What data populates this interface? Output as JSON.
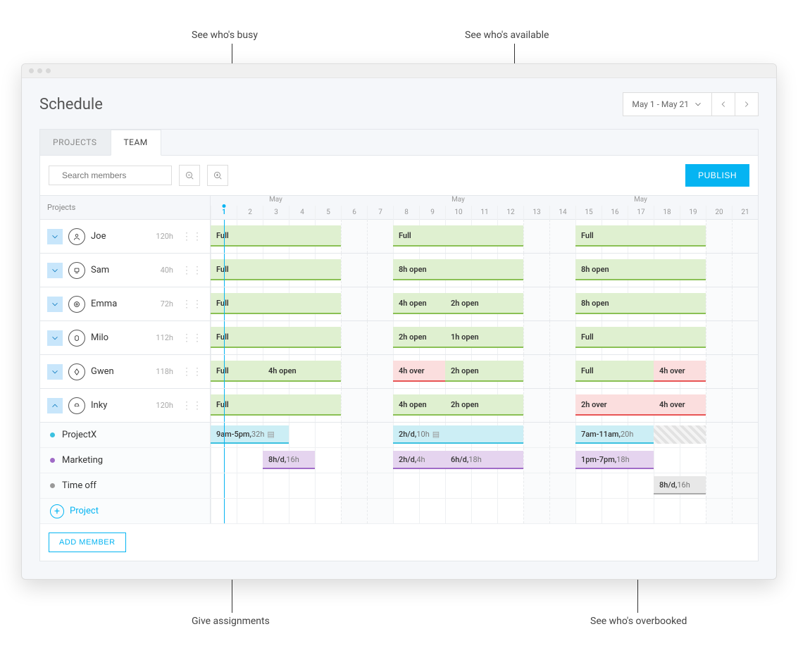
{
  "callouts": {
    "busy": "See who's busy",
    "available": "See who's available",
    "assignments": "Give assignments",
    "overbooked": "See who's overbooked"
  },
  "header": {
    "title": "Schedule",
    "date_range": "May 1 - May 21"
  },
  "tabs": {
    "projects": "PROJECTS",
    "team": "TEAM"
  },
  "toolbar": {
    "search_placeholder": "Search members",
    "publish": "PUBLISH"
  },
  "grid": {
    "left_header": "Projects",
    "month_label": "May",
    "days": [
      "1",
      "2",
      "3",
      "4",
      "5",
      "6",
      "7",
      "8",
      "9",
      "10",
      "11",
      "12",
      "13",
      "14",
      "15",
      "16",
      "17",
      "18",
      "19",
      "20",
      "21"
    ],
    "today": "1"
  },
  "members": [
    {
      "name": "Joe",
      "hours": "120h",
      "bars": [
        {
          "col": 0,
          "span": 5,
          "type": "green",
          "text": "Full"
        },
        {
          "col": 7,
          "span": 5,
          "type": "green",
          "text": "Full"
        },
        {
          "col": 14,
          "span": 5,
          "type": "green",
          "text": "Full"
        }
      ]
    },
    {
      "name": "Sam",
      "hours": "40h",
      "bars": [
        {
          "col": 0,
          "span": 5,
          "type": "green",
          "text": "Full"
        },
        {
          "col": 7,
          "span": 5,
          "type": "green",
          "text": "8h open"
        },
        {
          "col": 14,
          "span": 5,
          "type": "green",
          "text": "8h open"
        }
      ]
    },
    {
      "name": "Emma",
      "hours": "72h",
      "bars": [
        {
          "col": 0,
          "span": 5,
          "type": "green",
          "text": "Full"
        },
        {
          "col": 7,
          "span": 2,
          "type": "green",
          "text": "4h open"
        },
        {
          "col": 9,
          "span": 3,
          "type": "green",
          "text": "2h open"
        },
        {
          "col": 14,
          "span": 5,
          "type": "green",
          "text": "8h open"
        }
      ]
    },
    {
      "name": "Milo",
      "hours": "112h",
      "bars": [
        {
          "col": 0,
          "span": 5,
          "type": "green",
          "text": "Full"
        },
        {
          "col": 7,
          "span": 2,
          "type": "green",
          "text": "2h open"
        },
        {
          "col": 9,
          "span": 3,
          "type": "green",
          "text": "1h open"
        },
        {
          "col": 14,
          "span": 5,
          "type": "green",
          "text": "Full"
        }
      ]
    },
    {
      "name": "Gwen",
      "hours": "118h",
      "bars": [
        {
          "col": 0,
          "span": 2,
          "type": "green",
          "text": "Full"
        },
        {
          "col": 2,
          "span": 3,
          "type": "green",
          "text": "4h open"
        },
        {
          "col": 7,
          "span": 2,
          "type": "red",
          "text": "4h over"
        },
        {
          "col": 9,
          "span": 3,
          "type": "green",
          "text": "2h open"
        },
        {
          "col": 14,
          "span": 3,
          "type": "green",
          "text": "Full"
        },
        {
          "col": 17,
          "span": 2,
          "type": "red",
          "text": "4h over"
        }
      ]
    },
    {
      "name": "Inky",
      "hours": "120h",
      "expanded": true,
      "bars": [
        {
          "col": 0,
          "span": 5,
          "type": "green",
          "text": "Full"
        },
        {
          "col": 7,
          "span": 2,
          "type": "green",
          "text": "4h open"
        },
        {
          "col": 9,
          "span": 3,
          "type": "green",
          "text": "2h open"
        },
        {
          "col": 14,
          "span": 3,
          "type": "red",
          "text": "2h over"
        },
        {
          "col": 17,
          "span": 2,
          "type": "red",
          "text": "4h over"
        }
      ]
    }
  ],
  "subrows": [
    {
      "name": "ProjectX",
      "dot": "#3bc1e0",
      "bars": [
        {
          "col": 0,
          "span": 3,
          "type": "blue",
          "text": "9am-5pm, ",
          "light": "32h",
          "note": true
        },
        {
          "col": 7,
          "span": 5,
          "type": "blue",
          "text": "2h/d, ",
          "light": "10h",
          "note": true
        },
        {
          "col": 14,
          "span": 3,
          "type": "blue",
          "text": "7am-11am, ",
          "light": "20h"
        },
        {
          "col": 17,
          "span": 2,
          "type": "hatched",
          "text": ""
        }
      ]
    },
    {
      "name": "Marketing",
      "dot": "#a06bc7",
      "bars": [
        {
          "col": 2,
          "span": 2,
          "type": "purple",
          "text": "8h/d, ",
          "light": "16h"
        },
        {
          "col": 7,
          "span": 2,
          "type": "purple",
          "text": "2h/d, ",
          "light": "4h"
        },
        {
          "col": 9,
          "span": 3,
          "type": "purple",
          "text": "6h/d, ",
          "light": "18h"
        },
        {
          "col": 14,
          "span": 3,
          "type": "purple",
          "text": "1pm-7pm, ",
          "light": "18h"
        }
      ]
    },
    {
      "name": "Time off",
      "dot": "#999",
      "bars": [
        {
          "col": 17,
          "span": 2,
          "type": "gray",
          "text": "8h/d, ",
          "light": "16h"
        }
      ]
    }
  ],
  "add_project": "Project",
  "add_member": "ADD MEMBER",
  "colw": 37.0
}
